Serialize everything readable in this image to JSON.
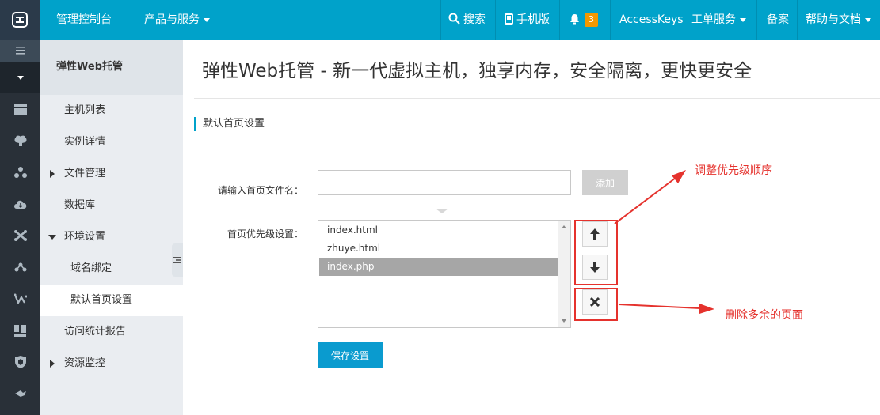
{
  "topbar": {
    "console": "管理控制台",
    "products": "产品与服务",
    "search": "搜索",
    "mobile": "手机版",
    "notify_count": "3",
    "access_keys": "AccessKeys",
    "tickets": "工单服务",
    "beian": "备案",
    "help": "帮助与文档",
    "bg_color": "#00a2ca"
  },
  "rail": {
    "icons": [
      "menu-icon",
      "dropdown-icon",
      "server-icon",
      "brain-icon",
      "cluster-icon",
      "cloud-icon",
      "shuffle-icon",
      "network-icon",
      "chart-icon",
      "layout-icon",
      "shield-icon",
      "tool-icon"
    ]
  },
  "sidebar": {
    "title": "弹性Web托管",
    "items": [
      {
        "label": "主机列表"
      },
      {
        "label": "实例详情"
      },
      {
        "label": "文件管理"
      },
      {
        "label": "数据库"
      },
      {
        "label": "环境设置"
      },
      {
        "label": "域名绑定"
      },
      {
        "label": "默认首页设置"
      },
      {
        "label": "访问统计报告"
      },
      {
        "label": "资源监控"
      }
    ]
  },
  "main": {
    "title": "弹性Web托管 - 新一代虚拟主机，独享内存，安全隔离，更快更安全",
    "section": "默认首页设置",
    "input_label": "请输入首页文件名：",
    "input_value": "",
    "add_button": "添加",
    "priority_label": "首页优先级设置：",
    "files": [
      "index.html",
      "zhuye.html",
      "index.php"
    ],
    "selected_file": "index.php",
    "save_button": "保存设置"
  },
  "annotations": {
    "priority_note": "调整优先级顺序",
    "delete_note": "删除多余的页面",
    "color": "#e5322d"
  }
}
